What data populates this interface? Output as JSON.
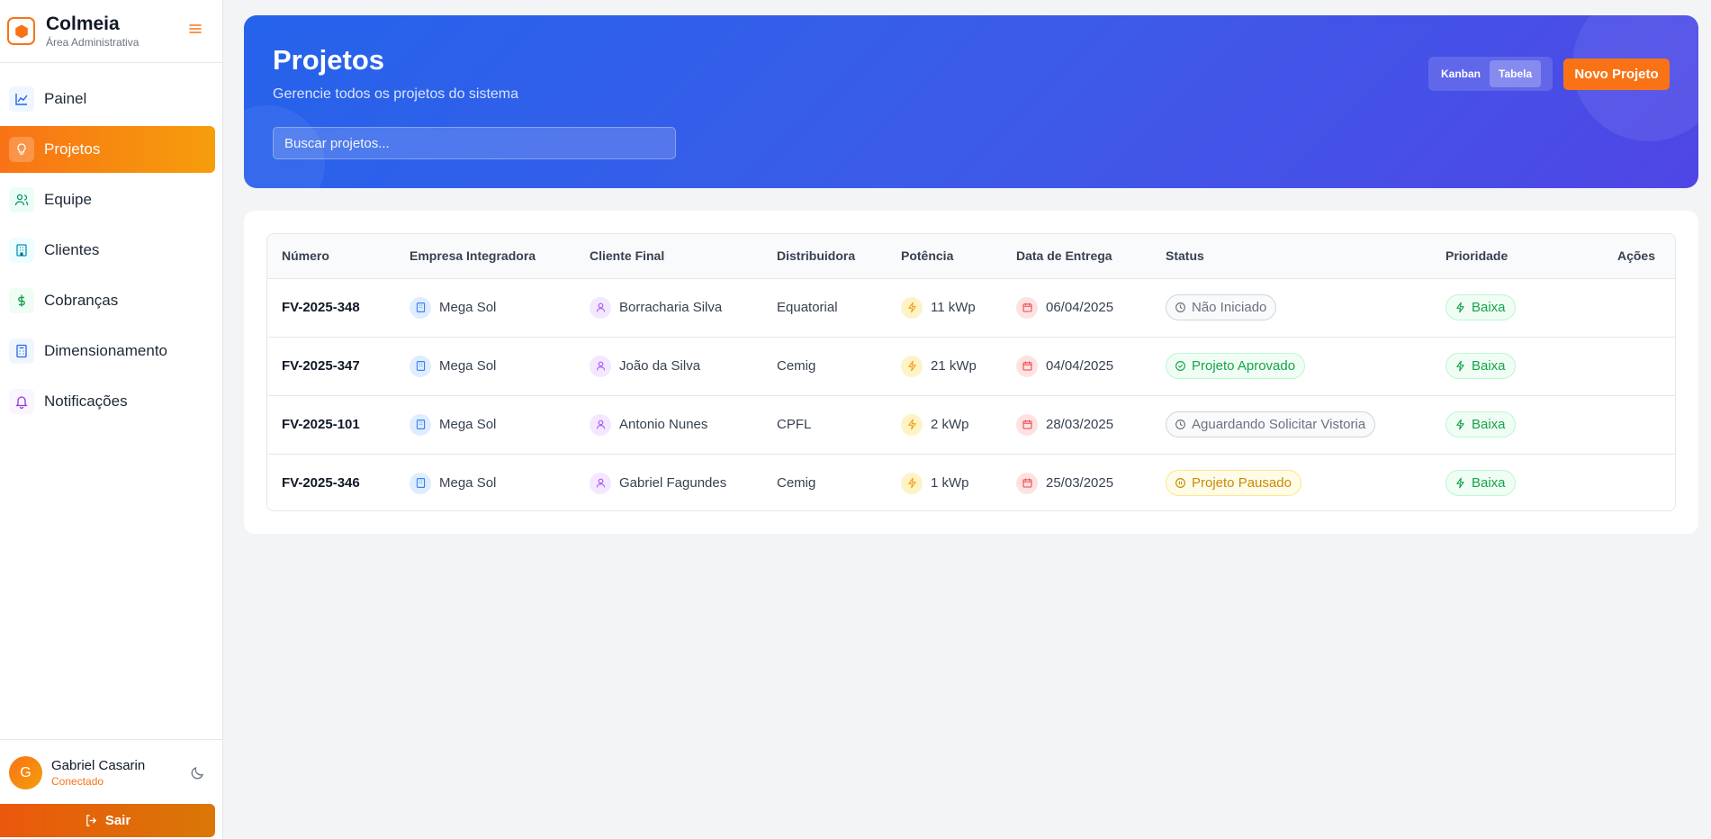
{
  "brand": {
    "name": "Colmeia",
    "subtitle": "Área Administrativa",
    "logo_icon": "hexagon-icon",
    "menu_icon": "hamburger-icon"
  },
  "sidebar": {
    "items": [
      {
        "label": "Painel",
        "icon": "chart-icon",
        "active": false
      },
      {
        "label": "Projetos",
        "icon": "lightbulb-icon",
        "active": true
      },
      {
        "label": "Equipe",
        "icon": "users-icon",
        "active": false
      },
      {
        "label": "Clientes",
        "icon": "building-icon",
        "active": false
      },
      {
        "label": "Cobranças",
        "icon": "dollar-icon",
        "active": false
      },
      {
        "label": "Dimensionamento",
        "icon": "calculator-icon",
        "active": false
      },
      {
        "label": "Notificações",
        "icon": "bell-icon",
        "active": false
      }
    ]
  },
  "user": {
    "initial": "G",
    "name": "Gabriel Casarin",
    "status": "Conectado",
    "logout_label": "Sair"
  },
  "header": {
    "title": "Projetos",
    "subtitle": "Gerencie todos os projetos do sistema",
    "search_placeholder": "Buscar projetos...",
    "view_kanban": "Kanban",
    "view_table": "Tabela",
    "active_view": "Tabela",
    "new_button": "Novo Projeto"
  },
  "table": {
    "columns": [
      "Número",
      "Empresa Integradora",
      "Cliente Final",
      "Distribuidora",
      "Potência",
      "Data de Entrega",
      "Status",
      "Prioridade",
      "Ações"
    ],
    "rows": [
      {
        "numero": "FV-2025-348",
        "empresa": "Mega Sol",
        "cliente": "Borracharia Silva",
        "distribuidora": "Equatorial",
        "potencia": "11 kWp",
        "data": "06/04/2025",
        "status": "Não Iniciado",
        "status_type": "gray",
        "prioridade": "Baixa"
      },
      {
        "numero": "FV-2025-347",
        "empresa": "Mega Sol",
        "cliente": "João da Silva",
        "distribuidora": "Cemig",
        "potencia": "21 kWp",
        "data": "04/04/2025",
        "status": "Projeto Aprovado",
        "status_type": "green",
        "prioridade": "Baixa"
      },
      {
        "numero": "FV-2025-101",
        "empresa": "Mega Sol",
        "cliente": "Antonio Nunes",
        "distribuidora": "CPFL",
        "potencia": "2 kWp",
        "data": "28/03/2025",
        "status": "Aguardando Solicitar Vistoria",
        "status_type": "gray",
        "prioridade": "Baixa"
      },
      {
        "numero": "FV-2025-346",
        "empresa": "Mega Sol",
        "cliente": "Gabriel Fagundes",
        "distribuidora": "Cemig",
        "potencia": "1 kWp",
        "data": "25/03/2025",
        "status": "Projeto Pausado",
        "status_type": "yellow",
        "prioridade": "Baixa"
      }
    ]
  },
  "colors": {
    "accent": "#f97316",
    "header_start": "#2563eb",
    "header_end": "#4f46e5"
  }
}
